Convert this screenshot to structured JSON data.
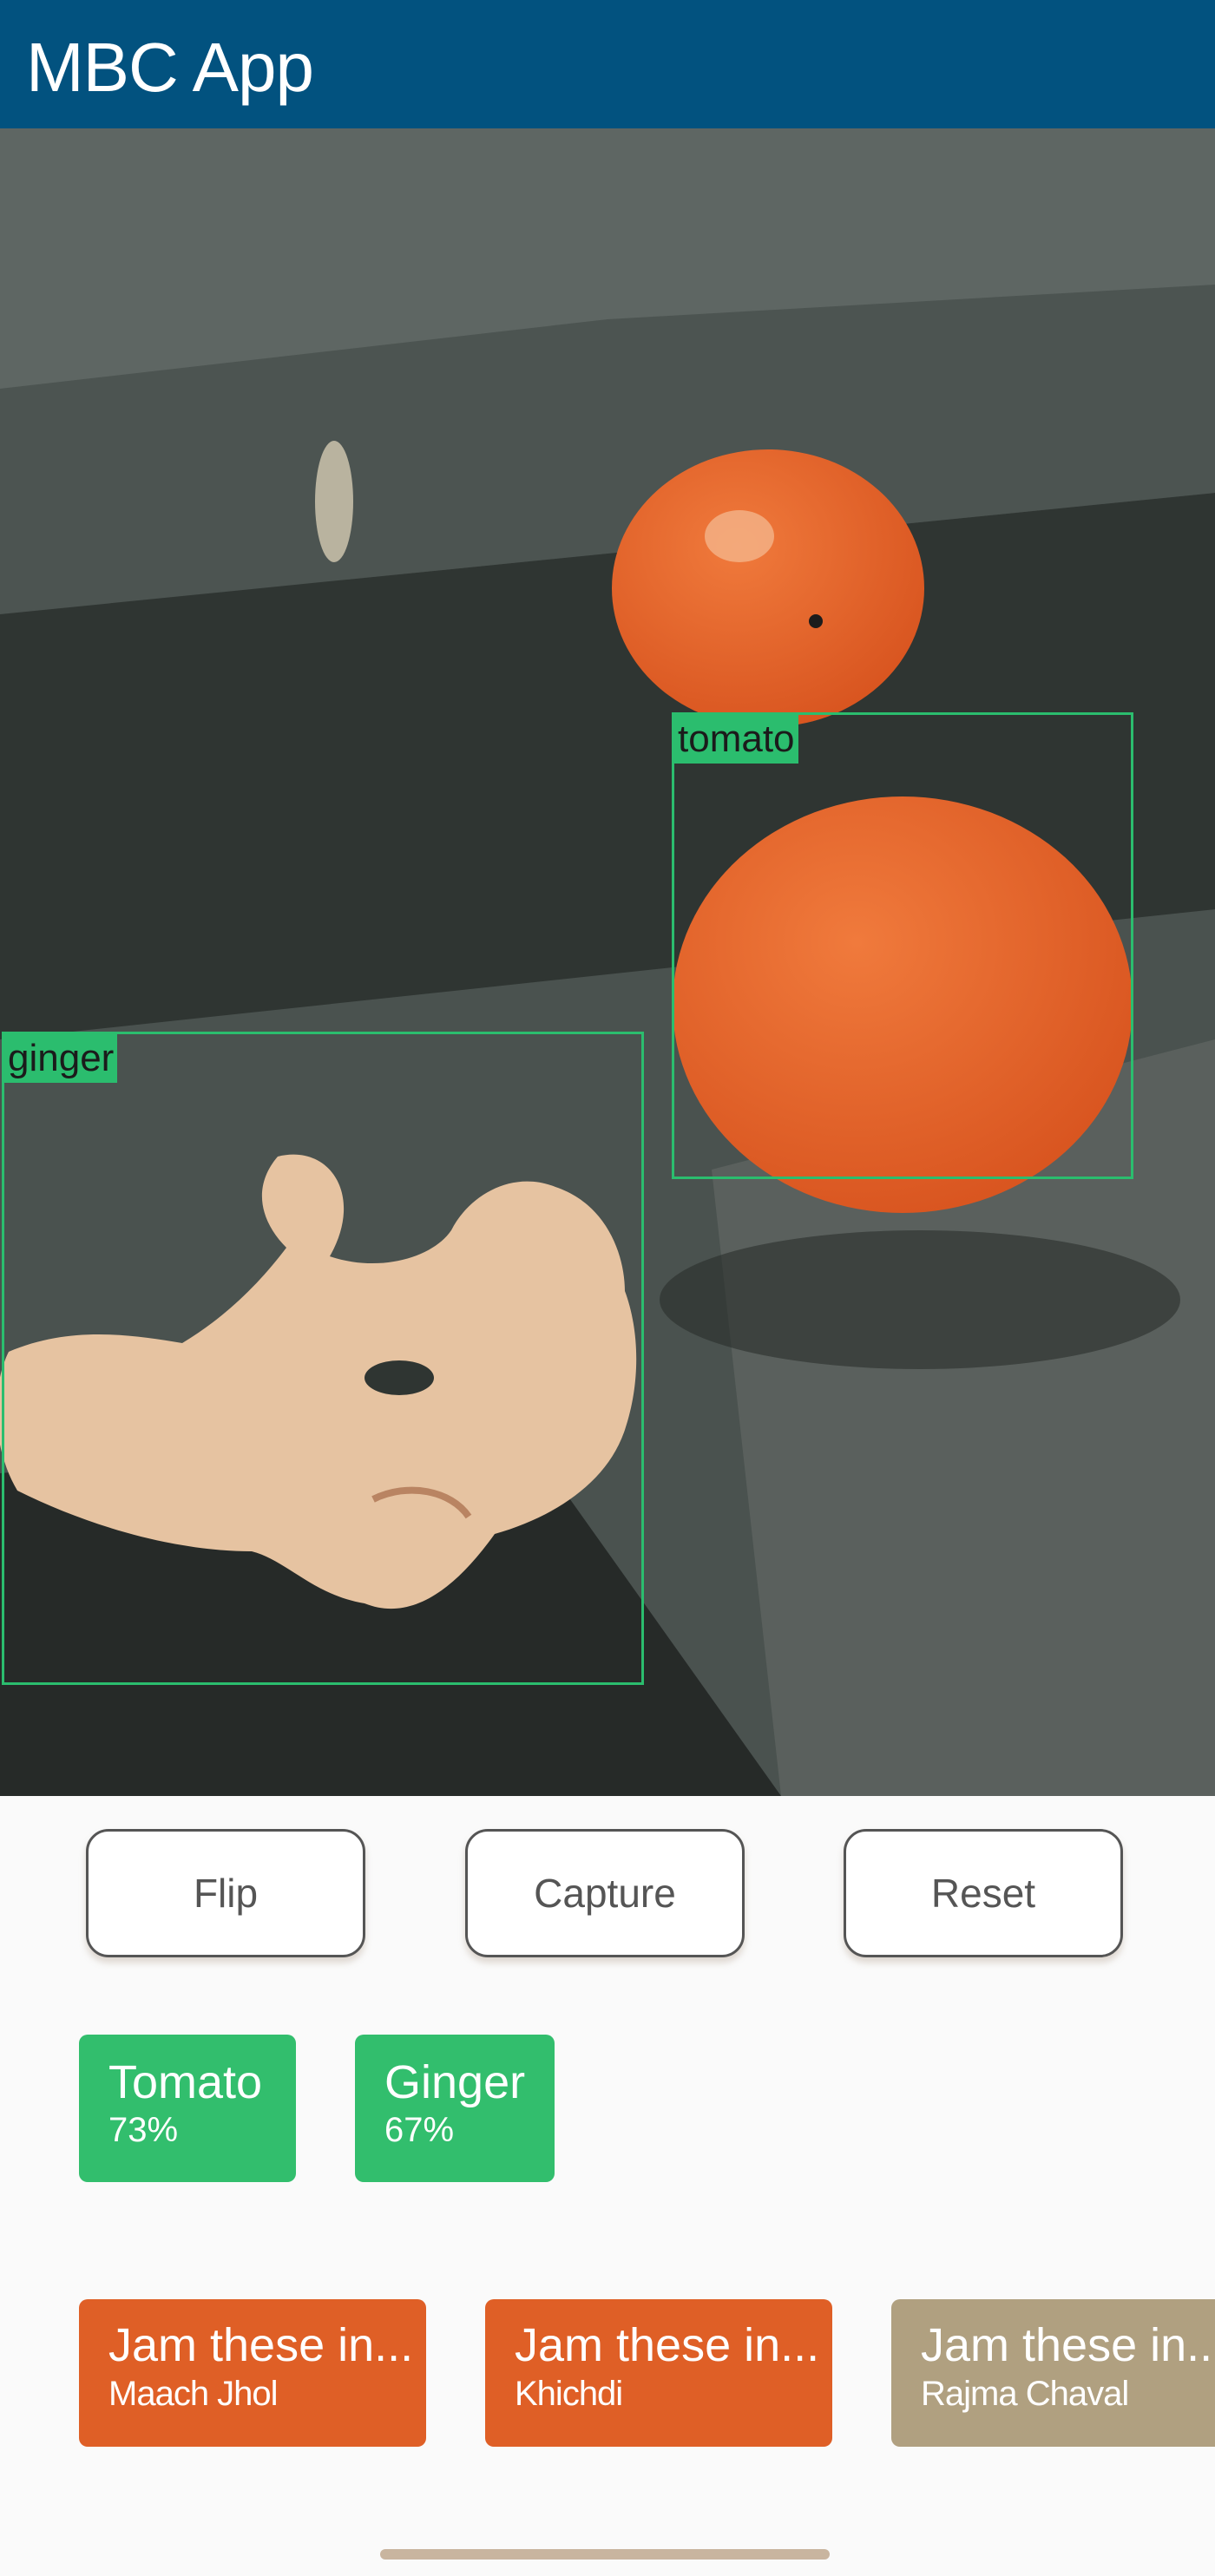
{
  "app": {
    "title": "MBC App"
  },
  "camera": {
    "detections": [
      {
        "label": "tomato"
      },
      {
        "label": "ginger"
      }
    ]
  },
  "controls": {
    "flip_label": "Flip",
    "capture_label": "Capture",
    "reset_label": "Reset"
  },
  "results": [
    {
      "name": "Tomato",
      "confidence": "73%"
    },
    {
      "name": "Ginger",
      "confidence": "67%"
    }
  ],
  "recipes": [
    {
      "title": "Jam these in...",
      "dish": "Maach Jhol"
    },
    {
      "title": "Jam these in...",
      "dish": "Khichdi"
    },
    {
      "title": "Jam these in...",
      "dish": "Rajma Chaval"
    }
  ],
  "colors": {
    "appbar": "#02527f",
    "detection_box": "#2bbd6e",
    "result_chip": "#32be6d",
    "recipe_card": "#df5f26",
    "recipe_card_faded": "#b0a080"
  }
}
